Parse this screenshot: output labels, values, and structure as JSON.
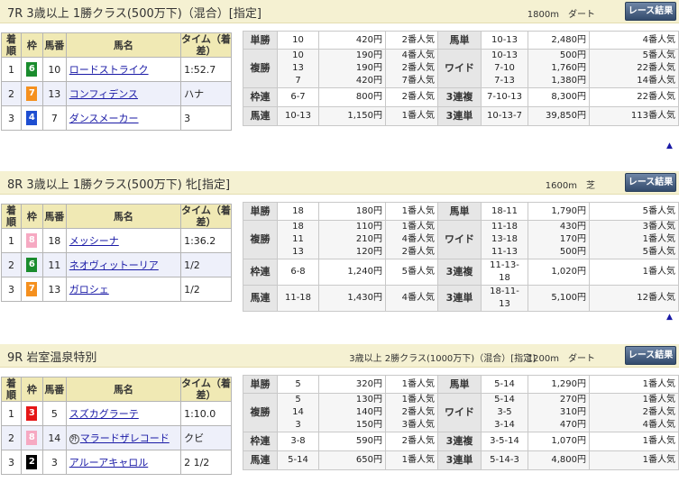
{
  "headers": {
    "rank": "着順",
    "waku": "枠",
    "umaban": "馬番",
    "name": "馬名",
    "time": "タイム（着差）"
  },
  "button_label": "レース結果",
  "up_icon": "▲",
  "races": [
    {
      "title": "7R 3歳以上 1勝クラス(500万下)（混合）[指定]",
      "subtitle": "",
      "distance": "1800m　ダート",
      "results": [
        {
          "rank": "1",
          "waku": "6",
          "umaban": "10",
          "name": "ロードストライク",
          "time": "1:52.7"
        },
        {
          "rank": "2",
          "waku": "7",
          "umaban": "13",
          "name": "コンフィデンス",
          "time": "ハナ"
        },
        {
          "rank": "3",
          "waku": "4",
          "umaban": "7",
          "name": "ダンスメーカー",
          "time": "3"
        }
      ],
      "tansho": {
        "label": "単勝",
        "combo": "10",
        "yen": "420円",
        "pop": "2番人気"
      },
      "umatan": {
        "label": "馬単",
        "combo": "10-13",
        "yen": "2,480円",
        "pop": "4番人気"
      },
      "fukusho": {
        "label": "複勝",
        "combos": [
          "10",
          "13",
          "7"
        ],
        "yens": [
          "190円",
          "190円",
          "420円"
        ],
        "pops": [
          "4番人気",
          "2番人気",
          "7番人気"
        ]
      },
      "wide": {
        "label": "ワイド",
        "combos": [
          "10-13",
          "7-10",
          "7-13"
        ],
        "yens": [
          "500円",
          "1,760円",
          "1,380円"
        ],
        "pops": [
          "5番人気",
          "22番人気",
          "14番人気"
        ]
      },
      "wakuren": {
        "label": "枠連",
        "combo": "6-7",
        "yen": "800円",
        "pop": "2番人気"
      },
      "sanfuku": {
        "label": "3連複",
        "combo": "7-10-13",
        "yen": "8,300円",
        "pop": "22番人気"
      },
      "umaren": {
        "label": "馬連",
        "combo": "10-13",
        "yen": "1,150円",
        "pop": "1番人気"
      },
      "santan": {
        "label": "3連単",
        "combo": "10-13-7",
        "yen": "39,850円",
        "pop": "113番人気"
      }
    },
    {
      "title": "8R 3歳以上 1勝クラス(500万下) 牝[指定]",
      "subtitle": "",
      "distance": "1600m　芝",
      "results": [
        {
          "rank": "1",
          "waku": "8",
          "umaban": "18",
          "name": "メッシーナ",
          "time": "1:36.2"
        },
        {
          "rank": "2",
          "waku": "6",
          "umaban": "11",
          "name": "ネオヴィットーリア",
          "time": "1/2"
        },
        {
          "rank": "3",
          "waku": "7",
          "umaban": "13",
          "name": "ガロシェ",
          "time": "1/2"
        }
      ],
      "tansho": {
        "label": "単勝",
        "combo": "18",
        "yen": "180円",
        "pop": "1番人気"
      },
      "umatan": {
        "label": "馬単",
        "combo": "18-11",
        "yen": "1,790円",
        "pop": "5番人気"
      },
      "fukusho": {
        "label": "複勝",
        "combos": [
          "18",
          "11",
          "13"
        ],
        "yens": [
          "110円",
          "210円",
          "120円"
        ],
        "pops": [
          "1番人気",
          "4番人気",
          "2番人気"
        ]
      },
      "wide": {
        "label": "ワイド",
        "combos": [
          "11-18",
          "13-18",
          "11-13"
        ],
        "yens": [
          "430円",
          "170円",
          "500円"
        ],
        "pops": [
          "3番人気",
          "1番人気",
          "5番人気"
        ]
      },
      "wakuren": {
        "label": "枠連",
        "combo": "6-8",
        "yen": "1,240円",
        "pop": "5番人気"
      },
      "sanfuku": {
        "label": "3連複",
        "combo": "11-13-18",
        "yen": "1,020円",
        "pop": "1番人気"
      },
      "umaren": {
        "label": "馬連",
        "combo": "11-18",
        "yen": "1,430円",
        "pop": "4番人気"
      },
      "santan": {
        "label": "3連単",
        "combo": "18-11-13",
        "yen": "5,100円",
        "pop": "12番人気"
      }
    },
    {
      "title": "9R 岩室温泉特別",
      "subtitle": "3歳以上 2勝クラス(1000万下)（混合）[指定]",
      "distance": "1200m　ダート",
      "results": [
        {
          "rank": "1",
          "waku": "3",
          "umaban": "5",
          "name": "スズカグラーテ",
          "time": "1:10.0",
          "gai": ""
        },
        {
          "rank": "2",
          "waku": "8",
          "umaban": "14",
          "name": "マラードザレコード",
          "time": "クビ",
          "gai": "外"
        },
        {
          "rank": "3",
          "waku": "2",
          "umaban": "3",
          "name": "アルーアキャロル",
          "time": "2 1/2",
          "gai": ""
        }
      ],
      "tansho": {
        "label": "単勝",
        "combo": "5",
        "yen": "320円",
        "pop": "1番人気"
      },
      "umatan": {
        "label": "馬単",
        "combo": "5-14",
        "yen": "1,290円",
        "pop": "1番人気"
      },
      "fukusho": {
        "label": "複勝",
        "combos": [
          "5",
          "14",
          "3"
        ],
        "yens": [
          "130円",
          "140円",
          "150円"
        ],
        "pops": [
          "1番人気",
          "2番人気",
          "3番人気"
        ]
      },
      "wide": {
        "label": "ワイド",
        "combos": [
          "5-14",
          "3-5",
          "3-14"
        ],
        "yens": [
          "270円",
          "310円",
          "470円"
        ],
        "pops": [
          "1番人気",
          "2番人気",
          "4番人気"
        ]
      },
      "wakuren": {
        "label": "枠連",
        "combo": "3-8",
        "yen": "590円",
        "pop": "2番人気"
      },
      "sanfuku": {
        "label": "3連複",
        "combo": "3-5-14",
        "yen": "1,070円",
        "pop": "1番人気"
      },
      "umaren": {
        "label": "馬連",
        "combo": "5-14",
        "yen": "650円",
        "pop": "1番人気"
      },
      "santan": {
        "label": "3連単",
        "combo": "5-14-3",
        "yen": "4,800円",
        "pop": "1番人気"
      }
    }
  ]
}
